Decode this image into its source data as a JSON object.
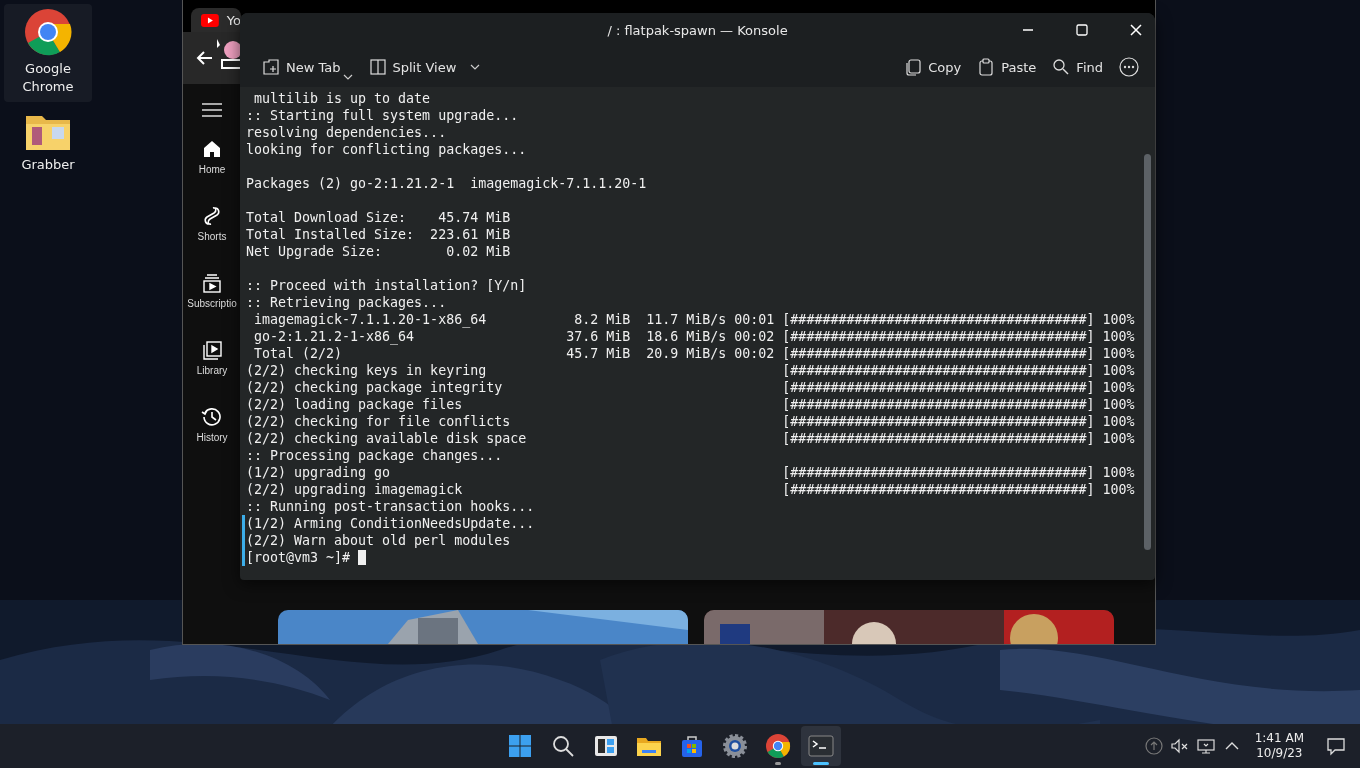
{
  "desktop": {
    "icons": [
      {
        "label": "Google Chrome",
        "kind": "chrome",
        "selected": true
      },
      {
        "label": "Grabber",
        "kind": "folder",
        "selected": false
      }
    ]
  },
  "browser": {
    "tab": {
      "title": "Yo"
    },
    "sidebar": [
      {
        "label": "Home",
        "kind": "home"
      },
      {
        "label": "Shorts",
        "kind": "shorts"
      },
      {
        "label": "Subscriptio",
        "kind": "subscriptions"
      },
      {
        "label": "Library",
        "kind": "library"
      },
      {
        "label": "History",
        "kind": "history"
      }
    ]
  },
  "konsole": {
    "title": "/ : flatpak-spawn — Konsole",
    "toolbar_left": [
      {
        "label": "New Tab",
        "kind": "new-tab",
        "dropdown": true
      },
      {
        "label": "Split View",
        "kind": "split",
        "dropdown": true
      }
    ],
    "toolbar_right": [
      {
        "label": "Copy",
        "kind": "copy"
      },
      {
        "label": "Paste",
        "kind": "paste"
      },
      {
        "label": "Find",
        "kind": "find"
      },
      {
        "kind": "more"
      }
    ],
    "terminal": {
      "blocks": [
        {
          "gap_before": false,
          "marked": false,
          "lines": [
            " multilib is up to date",
            ":: Starting full system upgrade...",
            "resolving dependencies...",
            "looking for conflicting packages..."
          ]
        },
        {
          "gap_before": true,
          "marked": false,
          "lines": [
            "Packages (2) go-2:1.21.2-1  imagemagick-7.1.1.20-1"
          ]
        },
        {
          "gap_before": true,
          "marked": false,
          "lines": [
            "Total Download Size:    45.74 MiB",
            "Total Installed Size:  223.61 MiB",
            "Net Upgrade Size:        0.02 MiB"
          ]
        },
        {
          "gap_before": true,
          "marked": false,
          "lines": [
            ":: Proceed with installation? [Y/n]",
            ":: Retrieving packages...",
            " imagemagick-7.1.1.20-1-x86_64           8.2 MiB  11.7 MiB/s 00:01 [#####################################] 100%",
            " go-2:1.21.2-1-x86_64                   37.6 MiB  18.6 MiB/s 00:02 [#####################################] 100%",
            " Total (2/2)                            45.7 MiB  20.9 MiB/s 00:02 [#####################################] 100%",
            "(2/2) checking keys in keyring                                     [#####################################] 100%",
            "(2/2) checking package integrity                                   [#####################################] 100%",
            "(2/2) loading package files                                        [#####################################] 100%",
            "(2/2) checking for file conflicts                                  [#####################################] 100%",
            "(2/2) checking available disk space                                [#####################################] 100%",
            ":: Processing package changes...",
            "(1/2) upgrading go                                                 [#####################################] 100%",
            "(2/2) upgrading imagemagick                                        [#####################################] 100%",
            ":: Running post-transaction hooks..."
          ]
        },
        {
          "gap_before": false,
          "marked": true,
          "lines": [
            "(1/2) Arming ConditionNeedsUpdate...",
            "(2/2) Warn about old perl modules"
          ]
        }
      ],
      "prompt": "[root@vm3 ~]#"
    }
  },
  "taskbar": {
    "apps": [
      {
        "kind": "start",
        "running": false,
        "active": false
      },
      {
        "kind": "search",
        "running": false,
        "active": false
      },
      {
        "kind": "widgets",
        "running": false,
        "active": false
      },
      {
        "kind": "explorer",
        "running": false,
        "active": false
      },
      {
        "kind": "store",
        "running": false,
        "active": false
      },
      {
        "kind": "settings",
        "running": false,
        "active": false
      },
      {
        "kind": "chrome",
        "running": true,
        "active": false
      },
      {
        "kind": "terminal",
        "running": true,
        "active": true
      }
    ],
    "tray": [
      {
        "kind": "update"
      },
      {
        "kind": "muted"
      },
      {
        "kind": "display"
      },
      {
        "kind": "chevron"
      }
    ],
    "clock": {
      "time": "1:41 AM",
      "date": "10/9/23"
    }
  }
}
